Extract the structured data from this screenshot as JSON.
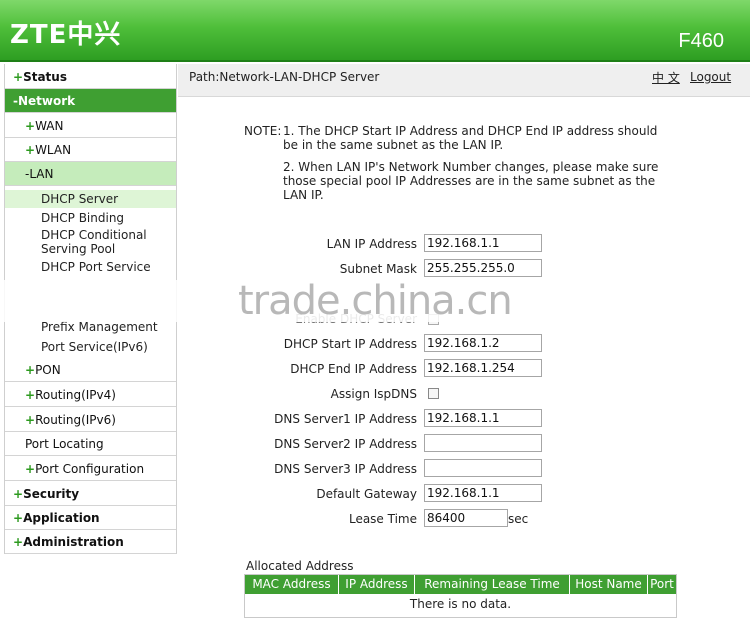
{
  "header": {
    "logo": "ZTE中兴",
    "model": "F460"
  },
  "sidebar": {
    "status": "Status",
    "network": "Network",
    "wan": "WAN",
    "wlan": "WLAN",
    "lan": "LAN",
    "lan_items": [
      "DHCP Server",
      "DHCP Binding",
      "DHCP Conditional",
      "Serving Pool",
      "DHCP Port Service",
      "Prefix Management",
      "Port Service(IPv6)"
    ],
    "pon": "PON",
    "routing_ipv4": "Routing(IPv4)",
    "routing_ipv6": "Routing(IPv6)",
    "port_locating": "Port Locating",
    "port_configuration": "Port Configuration",
    "security": "Security",
    "application": "Application",
    "administration": "Administration"
  },
  "pathbar": {
    "path": "Path:Network-LAN-DHCP Server",
    "lang": "中 文",
    "logout": "Logout"
  },
  "note": {
    "label": "NOTE:",
    "line1a": "1. The DHCP Start IP Address and DHCP End IP address should",
    "line1b": "be in the same subnet as the LAN IP.",
    "line2a": "2. When LAN IP's Network Number changes, please make sure",
    "line2b": "those special pool IP Addresses are in the same subnet as the",
    "line2c": "LAN IP."
  },
  "form": {
    "lan_ip_label": "LAN IP Address",
    "lan_ip": "192.168.1.1",
    "subnet_label": "Subnet Mask",
    "subnet": "255.255.255.0",
    "enable_dhcp_label": "Enable DHCP Server",
    "start_label": "DHCP Start IP Address",
    "start": "192.168.1.2",
    "end_label": "DHCP End IP Address",
    "end": "192.168.1.254",
    "isp_dns_label": "Assign IspDNS",
    "dns1_label": "DNS Server1 IP Address",
    "dns1": "192.168.1.1",
    "dns2_label": "DNS Server2 IP Address",
    "dns2": "",
    "dns3_label": "DNS Server3 IP Address",
    "dns3": "",
    "gateway_label": "Default Gateway",
    "gateway": "192.168.1.1",
    "lease_label": "Lease Time",
    "lease": "86400",
    "lease_unit": "sec"
  },
  "watermark": "trade.china.cn",
  "allocated": {
    "title": "Allocated Address",
    "columns": [
      "MAC Address",
      "IP Address",
      "Remaining Lease Time",
      "Host Name",
      "Port"
    ],
    "empty": "There is no data."
  }
}
